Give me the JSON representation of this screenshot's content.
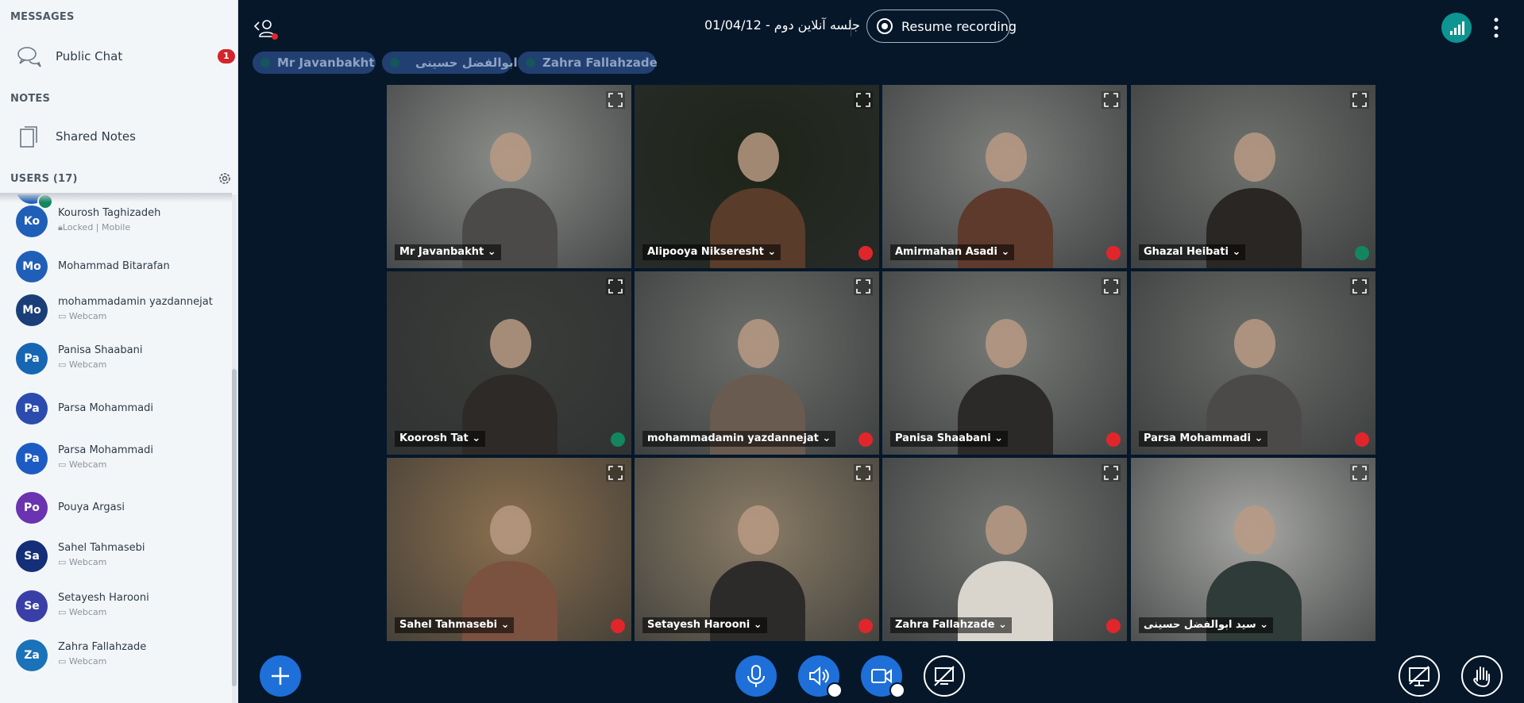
{
  "sidebar": {
    "messages_title": "MESSAGES",
    "public_chat": "Public Chat",
    "unread_count": "1",
    "notes_title": "NOTES",
    "shared_notes": "Shared Notes",
    "users_title": "USERS (17)",
    "users": [
      {
        "initials": "Ko",
        "name": "Kourosh Taghizadeh",
        "status": "Locked | Mobile",
        "mic": "muted"
      },
      {
        "initials": "Mo",
        "name": "Mohammad Bitarafan",
        "status": "",
        "mic": "muted"
      },
      {
        "initials": "Mo",
        "name": "mohammadamin yazdannejat",
        "status": "Webcam",
        "mic": "muted"
      },
      {
        "initials": "Pa",
        "name": "Panisa Shaabani",
        "status": "Webcam",
        "mic": "muted"
      },
      {
        "initials": "Pa",
        "name": "Parsa Mohammadi",
        "status": "",
        "mic": "none"
      },
      {
        "initials": "Pa",
        "name": "Parsa Mohammadi",
        "status": "Webcam",
        "mic": "muted"
      },
      {
        "initials": "Po",
        "name": "Pouya Argasi",
        "status": "",
        "mic": "muted"
      },
      {
        "initials": "Sa",
        "name": "Sahel Tahmasebi",
        "status": "Webcam",
        "mic": "muted"
      },
      {
        "initials": "Se",
        "name": "Setayesh Harooni",
        "status": "Webcam",
        "mic": "muted"
      },
      {
        "initials": "Za",
        "name": "Zahra Fallahzade",
        "status": "Webcam",
        "mic": "active"
      }
    ]
  },
  "header": {
    "title": "جلسه آنلاین دوم - 01/04/12",
    "record_label": "Resume recording"
  },
  "talking": [
    "Mr Javanbakht",
    "سید ابوالفضل حسینی",
    "Zahra Fallahzade"
  ],
  "videos": [
    {
      "name": "Mr Javanbakht",
      "status": "none"
    },
    {
      "name": "Alipooya Nikseresht",
      "status": "muted"
    },
    {
      "name": "Amirmahan Asadi",
      "status": "muted"
    },
    {
      "name": "Ghazal Heibati",
      "status": "listen"
    },
    {
      "name": "Koorosh Tat",
      "status": "listen"
    },
    {
      "name": "mohammadamin yazdannejat",
      "status": "muted"
    },
    {
      "name": "Panisa Shaabani",
      "status": "muted"
    },
    {
      "name": "Parsa Mohammadi",
      "status": "muted"
    },
    {
      "name": "Sahel Tahmasebi",
      "status": "muted"
    },
    {
      "name": "Setayesh Harooni",
      "status": "muted"
    },
    {
      "name": "Zahra Fallahzade",
      "status": "muted"
    },
    {
      "name": "سید ابوالفضل حسینی",
      "status": "none"
    }
  ],
  "colors": {
    "background": "#06172a",
    "accent": "#1f6fd9",
    "muted": "#e0262b",
    "talking_pill": "#213f71",
    "connection": "#0c9591"
  },
  "icons": {
    "public_chat": "chat-bubbles-icon",
    "shared_notes": "notes-icon",
    "settings": "gear-icon",
    "leave": "leave-user-icon",
    "connection": "signal-bars-icon",
    "options": "kebab-icon",
    "fullscreen": "expand-icon",
    "actions": "plus-icon",
    "mic": "microphone-icon",
    "audio": "speaker-icon",
    "video": "camera-icon",
    "screenshare": "screenshare-off-icon",
    "presentation": "presentation-icon",
    "raise_hand": "hand-icon"
  }
}
